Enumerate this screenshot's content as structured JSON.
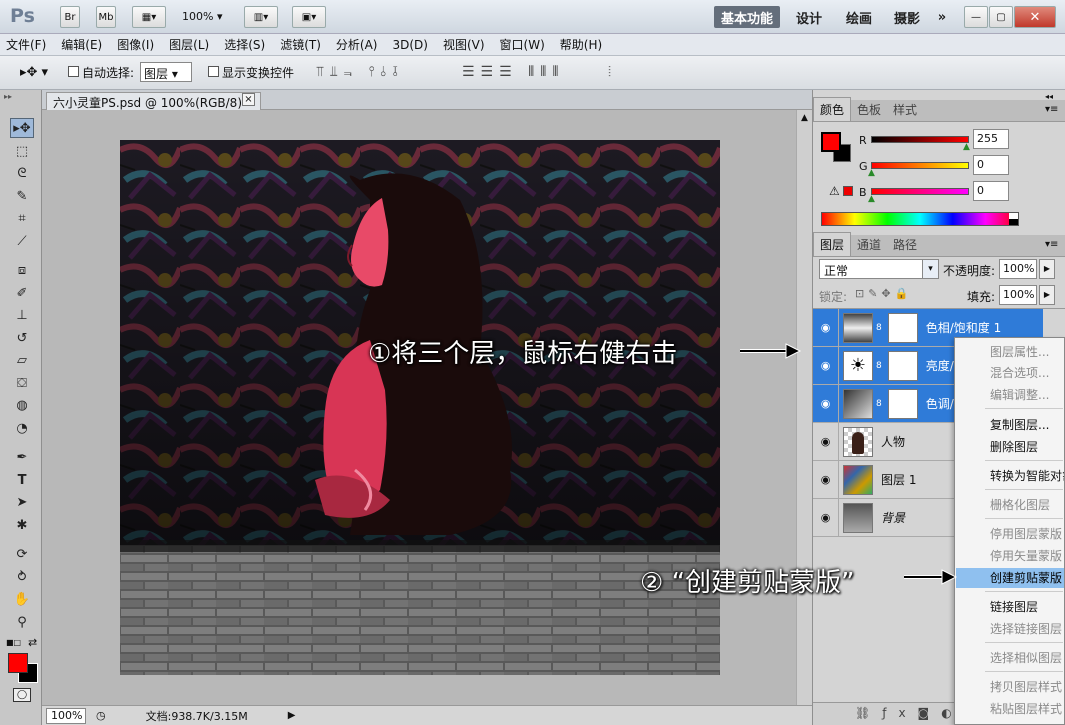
{
  "app": {
    "logo": "Ps",
    "zoom": "100%",
    "btn_br": "Br",
    "btn_mb": "Mb"
  },
  "workspaces": [
    {
      "label": "基本功能",
      "active": true
    },
    {
      "label": "设计"
    },
    {
      "label": "绘画"
    },
    {
      "label": "摄影"
    },
    {
      "label": "»"
    }
  ],
  "menu": [
    "文件(F)",
    "编辑(E)",
    "图像(I)",
    "图层(L)",
    "选择(S)",
    "滤镜(T)",
    "分析(A)",
    "3D(D)",
    "视图(V)",
    "窗口(W)",
    "帮助(H)"
  ],
  "options": {
    "auto_select_label": "自动选择:",
    "auto_select_value": "图层",
    "show_transform_label": "显示变换控件"
  },
  "document": {
    "tab_title": "六小灵童PS.psd @ 100%(RGB/8) *",
    "close": "×"
  },
  "status": {
    "zoom": "100%",
    "doc_info": "文档:938.7K/3.15M"
  },
  "color_panel": {
    "tabs": [
      "颜色",
      "色板",
      "样式"
    ],
    "channels": [
      {
        "name": "R",
        "value": "255"
      },
      {
        "name": "G",
        "value": "0"
      },
      {
        "name": "B",
        "value": "0"
      }
    ],
    "fg_color": "#ff0000",
    "bg_color": "#000000"
  },
  "layers_panel": {
    "tabs": [
      "图层",
      "通道",
      "路径"
    ],
    "blend_mode": "正常",
    "opacity_label": "不透明度:",
    "opacity": "100%",
    "lock_label": "锁定:",
    "fill_label": "填充:",
    "fill": "100%",
    "layers": [
      {
        "name": "色相/饱和度 1",
        "selected": true
      },
      {
        "name": "亮度/",
        "selected": true
      },
      {
        "name": "色调/",
        "selected": true
      },
      {
        "name": "人物",
        "selected": false
      },
      {
        "name": "图层 1",
        "selected": false
      },
      {
        "name": "背景",
        "selected": false
      }
    ]
  },
  "context_menu": {
    "items": [
      {
        "label": "图层属性...",
        "disabled": true
      },
      {
        "label": "混合选项...",
        "disabled": true
      },
      {
        "label": "编辑调整...",
        "disabled": true
      },
      {
        "label": "复制图层...",
        "disabled": false
      },
      {
        "label": "删除图层",
        "disabled": false
      },
      {
        "label": "转换为智能对象",
        "disabled": false
      },
      {
        "label": "栅格化图层",
        "disabled": true
      },
      {
        "label": "停用图层蒙版",
        "disabled": true
      },
      {
        "label": "停用矢量蒙版",
        "disabled": true
      },
      {
        "label": "创建剪贴蒙版",
        "disabled": false,
        "highlighted": true
      },
      {
        "label": "链接图层",
        "disabled": false
      },
      {
        "label": "选择链接图层",
        "disabled": true
      },
      {
        "label": "选择相似图层",
        "disabled": true
      },
      {
        "label": "拷贝图层样式",
        "disabled": true
      },
      {
        "label": "粘贴图层样式",
        "disabled": true
      }
    ]
  },
  "annotations": {
    "step1": "①将三个层，鼠标右健右击",
    "step2": "② “创建剪贴蒙版”"
  }
}
